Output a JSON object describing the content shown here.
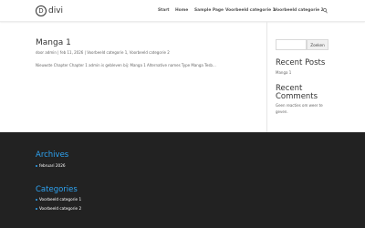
{
  "header": {
    "logo_text": "divi",
    "logo_mark": "D",
    "nav": [
      {
        "label": "Start"
      },
      {
        "label": "Home"
      },
      {
        "label": "Sample Page"
      },
      {
        "label": "Voorbeeld categorie 1"
      },
      {
        "label": "Voorbeeld categorie 2"
      }
    ],
    "search_icon": "search-icon"
  },
  "post": {
    "title": "Manga 1",
    "meta_prefix": "door ",
    "author": "admin",
    "sep1": " | ",
    "date": "feb 11, 2026",
    "sep2": " | ",
    "category1": "Voorbeeld categorie 1",
    "comma": ", ",
    "category2": "Voorbeeld categorie 2",
    "excerpt": "Nieuwste Chapter Chapter 1 admin is gebleven bij: Manga 1 Alternative names Type Manga Tesb..."
  },
  "sidebar": {
    "search_placeholder": "",
    "search_button": "Zoeken",
    "recent_posts_title": "Recent Posts",
    "recent_posts": [
      "Manga 1"
    ],
    "recent_comments_title": "Recent Comments",
    "recent_comments_text": "Geen reacties om weer te geven."
  },
  "footer": {
    "archives_title": "Archives",
    "archives": [
      "februari 2026"
    ],
    "categories_title": "Categories",
    "categories": [
      "Voorbeeld categorie 1",
      "Voorbeeld categorie 2"
    ]
  },
  "colors": {
    "accent": "#2ea3f2",
    "footer_bg": "#222222"
  }
}
